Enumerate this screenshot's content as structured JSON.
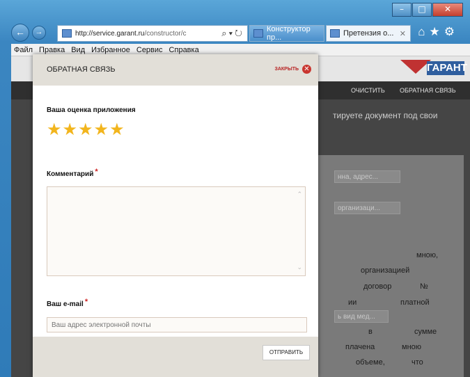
{
  "browser": {
    "address_host": "http://service.garant.ru",
    "address_path": "/constructor/c",
    "tabs": [
      {
        "label": "Конструктор пр..."
      },
      {
        "label": "Претензия о..."
      }
    ]
  },
  "menu": [
    "Файл",
    "Правка",
    "Вид",
    "Избранное",
    "Сервис",
    "Справка"
  ],
  "site": {
    "nav": {
      "clear": "ОЧИСТИТЬ",
      "feedback": "ОБРАТНАЯ СВЯЗЬ"
    },
    "logo_text": "ГАРАНТ",
    "intro_text": "тируете документ под свои",
    "field_placeholders": [
      "нна, адрес...",
      "организаци...",
      "ь вид мед..."
    ],
    "body_words": [
      "мною,",
      "организацией",
      "договор",
      "№",
      "ии",
      "платной",
      "в",
      "сумме",
      "плачена",
      "мною",
      "объеме,",
      "что"
    ]
  },
  "dialog": {
    "title": "ОБРАТНАЯ СВЯЗЬ",
    "close_label": "ЗАКРЫТЬ",
    "rating_label": "Ваша оценка приложения",
    "stars": 5,
    "comment_label": "Комментарий",
    "comment_value": "",
    "email_label": "Ваш e-mail",
    "email_placeholder": "Ваш адрес электронной почты",
    "send_label": "ОТПРАВИТЬ"
  }
}
